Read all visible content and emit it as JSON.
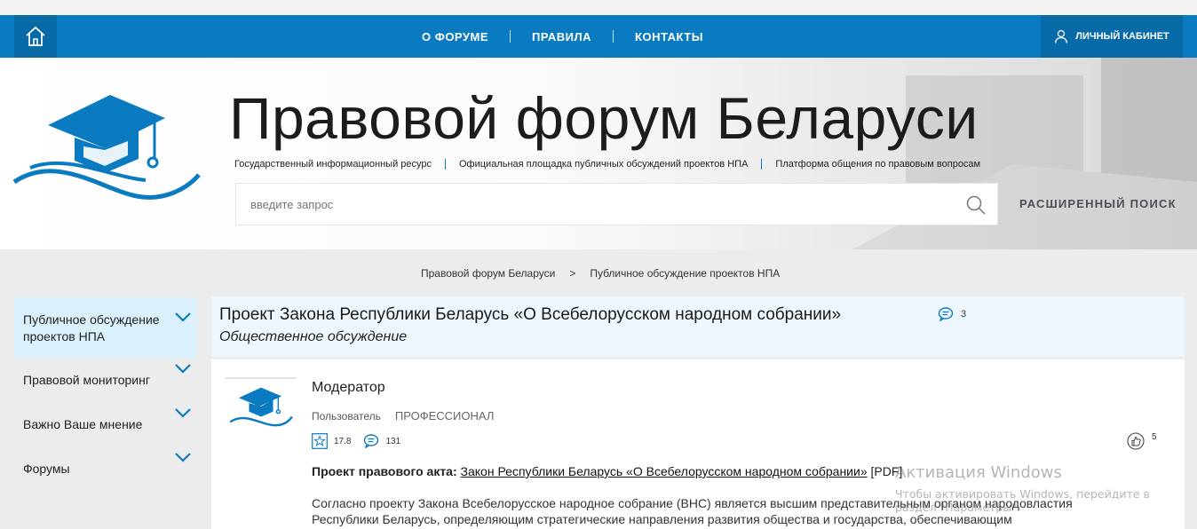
{
  "nav": {
    "links": [
      "О ФОРУМЕ",
      "ПРАВИЛА",
      "КОНТАКТЫ"
    ],
    "cabinet_label": "ЛИЧНЫЙ КАБИНЕТ",
    "home_icon": "home-icon",
    "user_icon": "user-icon"
  },
  "header": {
    "title": "Правовой форум Беларуси",
    "taglines": [
      "Государственный информационный ресурс",
      "Официальная площадка публичных обсуждений проектов НПА",
      "Платформа общения по правовым вопросам"
    ],
    "search_placeholder": "введите запрос",
    "advanced_search": "РАСШИРЕННЫЙ ПОИСК"
  },
  "breadcrumb": {
    "home": "Правовой форум Беларуси",
    "separator": ">",
    "current": "Публичное обсуждение проектов НПА"
  },
  "sidebar": {
    "items": [
      {
        "label": "Публичное обсуждение проектов НПА",
        "active": true
      },
      {
        "label": "Правовой мониторинг",
        "active": false
      },
      {
        "label": "Важно Ваше мнение",
        "active": false
      },
      {
        "label": "Форумы",
        "active": false
      }
    ]
  },
  "topic": {
    "title": "Проект Закона Республики Беларусь «О Всебелорусском народном собрании»",
    "subtitle": "Общественное обсуждение",
    "comments_count": "3"
  },
  "post": {
    "author": "Модератор",
    "role_label": "Пользователь",
    "role_level": "ПРОФЕССИОНАЛ",
    "rating": "17.8",
    "messages": "131",
    "likes": "5",
    "act_label": "Проект правового акта:",
    "act_link": "Закон Республики Беларусь «О Всебелорусском народном собрании»",
    "act_format": "[PDF]",
    "body_line1": "Согласно проекту Закона Всебелорусское народное собрание (ВНС) является высшим представительным органом народовластия",
    "body_line2": "Республики Беларусь, определяющим стратегические направления развития общества и государства, обеспечивающим"
  },
  "watermark": {
    "title": "Активация Windows",
    "line1": "Чтобы активировать Windows, перейдите в",
    "line2": "раздел \"Параметры\"."
  },
  "colors": {
    "brand_blue": "#0a7bc0",
    "brand_blue_dark": "#086aa6",
    "sidebar_active": "#daf0fb",
    "topic_bg": "#ecf6fc"
  }
}
